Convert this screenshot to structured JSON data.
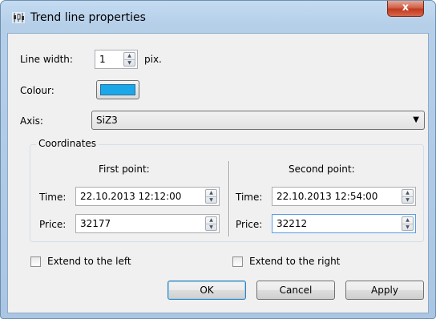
{
  "window": {
    "title": "Trend line properties",
    "app_icon": "chart-candles-icon",
    "close_label": "x"
  },
  "line_width": {
    "label": "Line width:",
    "value": "1",
    "unit": "pix."
  },
  "colour": {
    "label": "Colour:",
    "value": "#1aa8e8"
  },
  "axis": {
    "label": "Axis:",
    "selected": "SiZ3"
  },
  "coordinates": {
    "group_title": "Coordinates",
    "first_point": {
      "heading": "First point:",
      "time_label": "Time:",
      "time_value": "22.10.2013 12:12:00",
      "price_label": "Price:",
      "price_value": "32177"
    },
    "second_point": {
      "heading": "Second point:",
      "time_label": "Time:",
      "time_value": "22.10.2013 12:54:00",
      "price_label": "Price:",
      "price_value": "32212"
    }
  },
  "extend": {
    "left_label": "Extend to the left",
    "left_checked": false,
    "right_label": "Extend to the right",
    "right_checked": false
  },
  "buttons": {
    "ok": "OK",
    "cancel": "Cancel",
    "apply": "Apply"
  }
}
